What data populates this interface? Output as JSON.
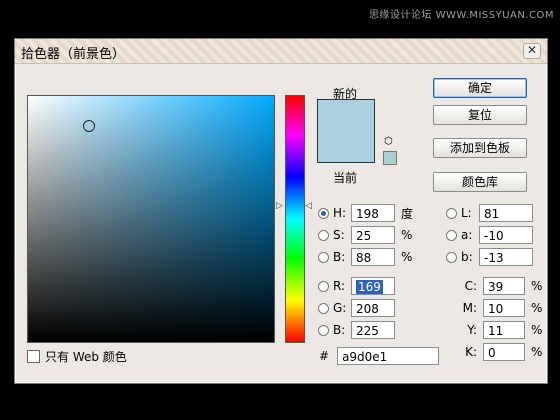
{
  "watermark": "思缘设计论坛 WWW.MISSYUAN.COM",
  "dialog": {
    "title": "拾色器（前景色）",
    "close_glyph": "✕",
    "only_web_colors_label": "只有 Web 颜色",
    "new_label": "新的",
    "current_label": "当前",
    "selected_color": "#a9d0e1",
    "buttons": {
      "ok": "确定",
      "reset": "复位",
      "add_to_swatches": "添加到色板",
      "color_libraries": "颜色库"
    },
    "hsb": {
      "h": {
        "label": "H:",
        "value": "198",
        "unit": "度"
      },
      "s": {
        "label": "S:",
        "value": "25",
        "unit": "%"
      },
      "b": {
        "label": "B:",
        "value": "88",
        "unit": "%"
      }
    },
    "rgb": {
      "r": {
        "label": "R:",
        "value": "169"
      },
      "g": {
        "label": "G:",
        "value": "208"
      },
      "b": {
        "label": "B:",
        "value": "225"
      }
    },
    "lab": {
      "l": {
        "label": "L:",
        "value": "81"
      },
      "a": {
        "label": "a:",
        "value": "-10"
      },
      "b": {
        "label": "b:",
        "value": "-13"
      }
    },
    "cmyk": {
      "c": {
        "label": "C:",
        "value": "39",
        "unit": "%"
      },
      "m": {
        "label": "M:",
        "value": "10",
        "unit": "%"
      },
      "y": {
        "label": "Y:",
        "value": "11",
        "unit": "%"
      },
      "k": {
        "label": "K:",
        "value": "0",
        "unit": "%"
      }
    },
    "hex": {
      "label": "#",
      "value": "a9d0e1"
    }
  }
}
